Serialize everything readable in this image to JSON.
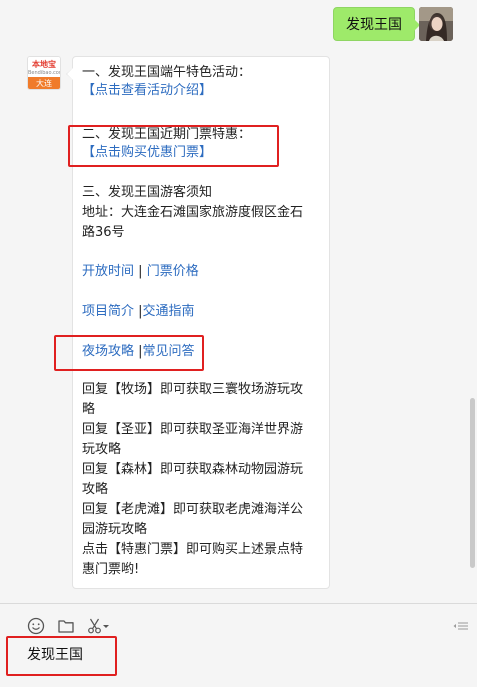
{
  "user_message": "发现王国",
  "bot_avatar": {
    "brand": "本地宝",
    "site": "Bendibao.com",
    "city": "大连"
  },
  "bot_message": {
    "section1_title": "一、发现王国端午特色活动：",
    "section1_link": "【点击查看活动介绍】",
    "section2_title": "二、发现王国近期门票特惠：",
    "section2_link": "【点击购买优惠门票】",
    "section3_title": "三、发现王国游客须知",
    "address_line1": "地址：大连金石滩国家旅游度假区金石",
    "address_line2": "路36号",
    "links": {
      "open_time": "开放时间",
      "ticket_price": "门票价格",
      "project_intro": "项目简介",
      "traffic_guide": "交通指南",
      "night_guide": "夜场攻略",
      "faq": "常见问答",
      "sep": "|"
    },
    "replies": [
      "回复【牧场】即可获取三寰牧场游玩攻",
      "略",
      "回复【圣亚】即可获取圣亚海洋世界游",
      "玩攻略",
      "回复【森林】即可获取森林动物园游玩",
      "攻略",
      "回复【老虎滩】即可获取老虎滩海洋公",
      "园游玩攻略",
      "点击【特惠门票】即可购买上述景点特",
      "惠门票哟!"
    ]
  },
  "input": {
    "value": "发现王国"
  },
  "toolbar_icons": [
    "emoji-icon",
    "folder-icon",
    "scissors-icon",
    "chevron-down-icon",
    "collapse-icon"
  ],
  "colors": {
    "link": "#2d6cc0",
    "user_bubble": "#9eea6a",
    "highlight_box": "#e02020",
    "brand_orange": "#f07b2a"
  }
}
